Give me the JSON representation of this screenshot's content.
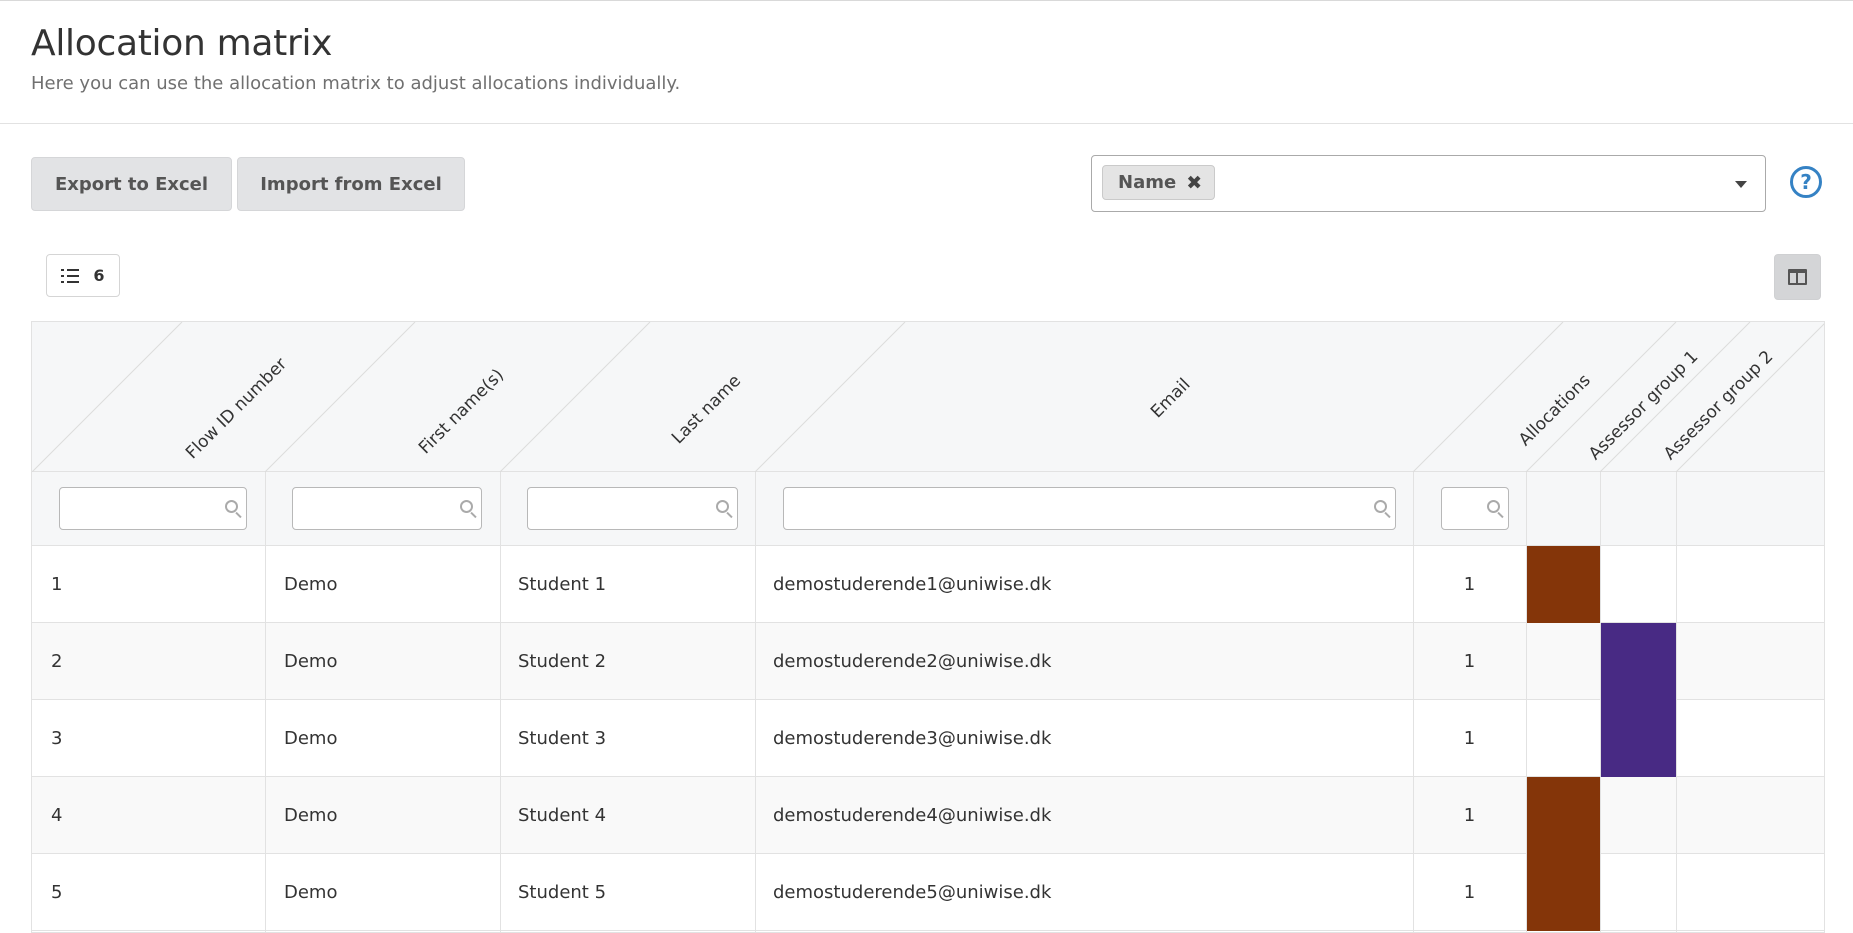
{
  "header": {
    "title": "Allocation matrix",
    "subtitle": "Here you can use the allocation matrix to adjust allocations individually."
  },
  "toolbar": {
    "export_label": "Export to Excel",
    "import_label": "Import from Excel",
    "filter_chip": "Name",
    "chip_remove_glyph": "✖",
    "help_glyph": "?"
  },
  "row_count": "6",
  "columns": [
    "Flow ID number",
    "First name(s)",
    "Last name",
    "Email",
    "Allocations",
    "Assessor group 1",
    "Assessor group 2"
  ],
  "colors": {
    "assessor_group_1": "#843509",
    "assessor_group_2": "#482a84",
    "help_accent": "#3582c4"
  },
  "rows": [
    {
      "id": "1",
      "first": "Demo",
      "last": "Student 1",
      "email": "demostuderende1@uniwise.dk",
      "allocations": "1",
      "group": 1
    },
    {
      "id": "2",
      "first": "Demo",
      "last": "Student 2",
      "email": "demostuderende2@uniwise.dk",
      "allocations": "1",
      "group": 2
    },
    {
      "id": "3",
      "first": "Demo",
      "last": "Student 3",
      "email": "demostuderende3@uniwise.dk",
      "allocations": "1",
      "group": 2
    },
    {
      "id": "4",
      "first": "Demo",
      "last": "Student 4",
      "email": "demostuderende4@uniwise.dk",
      "allocations": "1",
      "group": 1
    },
    {
      "id": "5",
      "first": "Demo",
      "last": "Student 5",
      "email": "demostuderende5@uniwise.dk",
      "allocations": "1",
      "group": 1
    }
  ]
}
